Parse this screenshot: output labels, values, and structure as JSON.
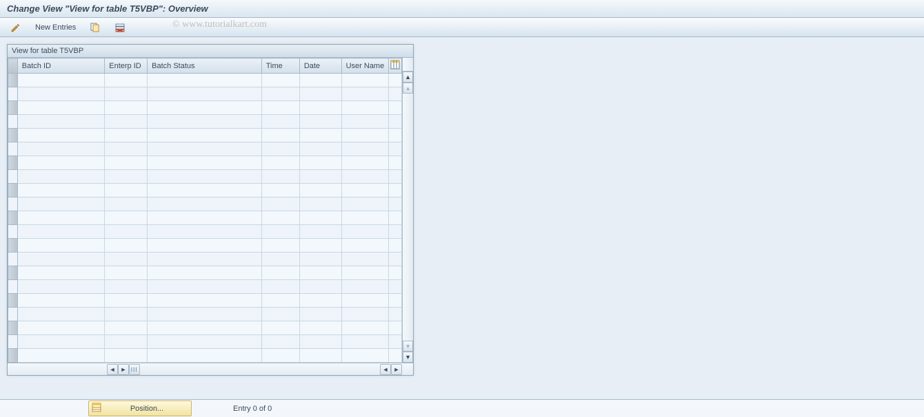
{
  "header": {
    "title": "Change View \"View for table T5VBP\": Overview"
  },
  "toolbar": {
    "new_entries_label": "New Entries"
  },
  "watermark": "© www.tutorialkart.com",
  "table": {
    "caption": "View for table T5VBP",
    "columns": [
      "Batch ID",
      "Enterp ID",
      "Batch Status",
      "Time",
      "Date",
      "User Name"
    ],
    "row_count_visible": 21,
    "rows": []
  },
  "footer": {
    "position_label": "Position...",
    "entry_status": "Entry 0 of 0"
  }
}
